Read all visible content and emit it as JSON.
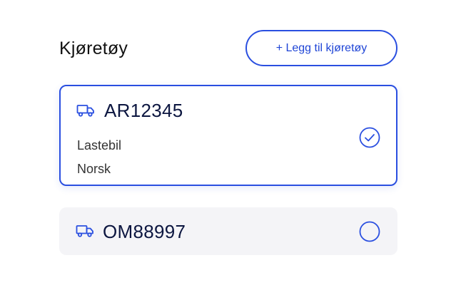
{
  "section": {
    "title": "Kjøretøy",
    "add_button_label": "+ Legg til kjøretøy"
  },
  "vehicles": [
    {
      "plate": "AR12345",
      "type": "Lastebil",
      "origin": "Norsk",
      "selected": true,
      "icon": "truck-icon"
    },
    {
      "plate": "OM88997",
      "selected": false,
      "icon": "truck-icon"
    }
  ],
  "colors": {
    "accent": "#2a4fe0",
    "plate_text": "#0c1640",
    "card_unselected_bg": "#f4f4f7"
  }
}
